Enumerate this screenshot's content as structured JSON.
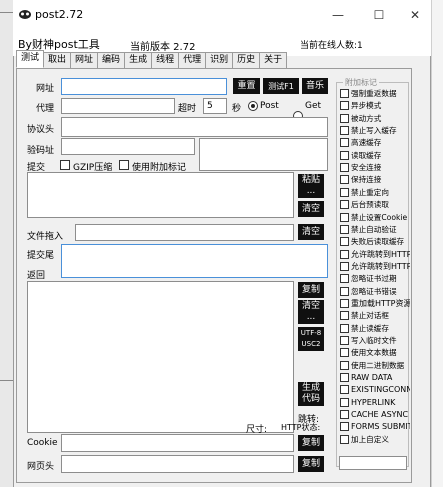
{
  "window": {
    "title": "post2.72",
    "min_glyph": "—",
    "max_glyph": "☐",
    "close_glyph": "✕"
  },
  "header": {
    "title": "By财神post工具",
    "version": "当前版本 2.72",
    "online": "当前在线人数:1"
  },
  "tabs": [
    "测试",
    "取出",
    "网址",
    "编码",
    "生成",
    "线程",
    "代理",
    "识别",
    "历史",
    "关于"
  ],
  "form": {
    "url_label": "网址",
    "reset_btn": "重置",
    "testf1_btn": "测试F1",
    "sound_btn": "音乐",
    "proxy_label": "代理",
    "timeout_label": "超时",
    "timeout_value": "5",
    "seconds_label": "秒",
    "post_label": "Post",
    "get_label": "Get",
    "protocol_label": "协议头",
    "captcha_label": "验码址",
    "submit_label": "提交",
    "gzip_label": "GZIP压缩",
    "attach_label": "使用附加标记",
    "paste_btn": "粘贴\n...",
    "clear_btn": "清空",
    "file_label": "文件拖入",
    "clear2_btn": "清空",
    "tail_label": "提交尾",
    "return_label": "返回",
    "copy_btn": "复制",
    "clear3_btn": "清空\n...",
    "encoding_btn": "UTF-8\nUSC2",
    "generate_btn": "生成\n代码",
    "jump_label": "跳转:",
    "size_label": "尺寸:",
    "http_status_label": "HTTP状态:",
    "cookie_label": "Cookie",
    "cookie_copy": "复制",
    "webhead_label": "网页头",
    "webhead_copy": "复制"
  },
  "options": {
    "title": "附加标记",
    "items": [
      "强制重返数据",
      "异步模式",
      "被动方式",
      "禁止写入缓存",
      "高速缓存",
      "读取缓存",
      "安全连接",
      "保持连接",
      "禁止重定向",
      "后台预读取",
      "禁止设置Cookie",
      "禁止自动验证",
      "失败后读取缓存",
      "允许跳转到HTTP",
      "允许跳转到HTTPS",
      "忽略证书过期",
      "忽略证书错误",
      "重加载HTTP资源",
      "禁止对话框",
      "禁止读缓存",
      "写入临时文件",
      "使用文本数据",
      "使用二进制数据",
      "RAW DATA",
      "EXISTINGCONNEC",
      "HYPERLINK",
      "CACHE ASYNC",
      "FORMS SUBMIT",
      "加上自定义"
    ]
  },
  "icons": {
    "app": "app-logo-icon"
  }
}
